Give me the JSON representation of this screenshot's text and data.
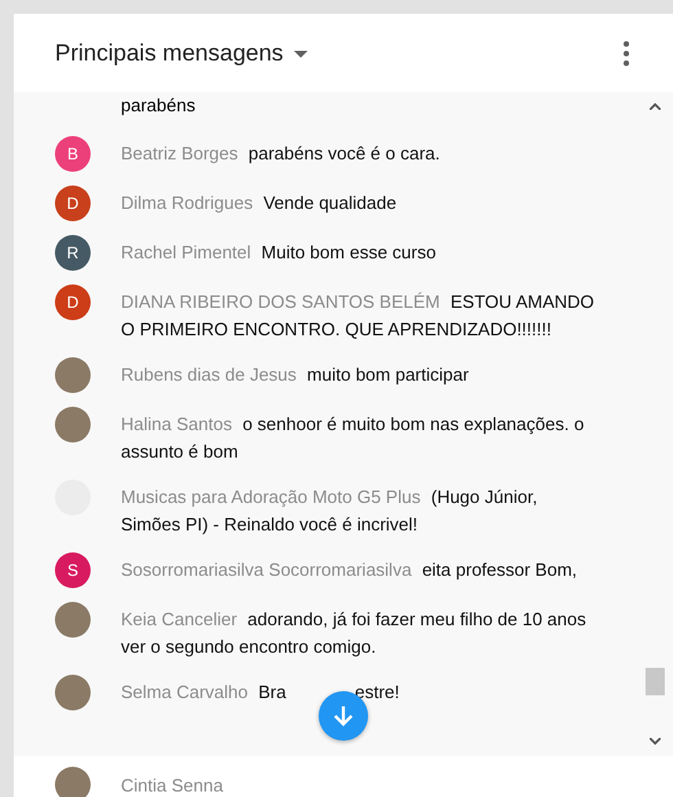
{
  "header": {
    "title": "Principais mensagens"
  },
  "partial_top": {
    "message": "parabéns"
  },
  "messages": [
    {
      "avatar": {
        "kind": "letter",
        "letter": "B",
        "color": "#ec407a"
      },
      "author": "Beatriz Borges",
      "message": "parabéns você é o cara."
    },
    {
      "avatar": {
        "kind": "letter",
        "letter": "D",
        "color": "#c8401c"
      },
      "author": "Dilma Rodrigues",
      "message": "Vende qualidade"
    },
    {
      "avatar": {
        "kind": "letter",
        "letter": "R",
        "color": "#455a64"
      },
      "author": "Rachel Pimentel",
      "message": "Muito bom esse curso"
    },
    {
      "avatar": {
        "kind": "letter",
        "letter": "D",
        "color": "#cc3d18"
      },
      "author": "DIANA RIBEIRO DOS SANTOS BELÉM",
      "message": "ESTOU AMANDO O PRIMEIRO ENCONTRO. QUE APRENDIZADO!!!!!!!"
    },
    {
      "avatar": {
        "kind": "photo"
      },
      "author": "Rubens dias de Jesus",
      "message": "muito bom participar"
    },
    {
      "avatar": {
        "kind": "photo"
      },
      "author": "Halina Santos",
      "message": "o senhoor é muito bom nas explanações. o assunto é bom"
    },
    {
      "avatar": {
        "kind": "logo"
      },
      "author": "Musicas para Adoração Moto G5 Plus",
      "message": "(Hugo Júnior, Simões PI) - Reinaldo você é incrivel!"
    },
    {
      "avatar": {
        "kind": "letter",
        "letter": "S",
        "color": "#d81b60"
      },
      "author": "Sosorromariasilva Socorromariasilva",
      "message": "eita professor Bom,"
    },
    {
      "avatar": {
        "kind": "photo"
      },
      "author": "Keia Cancelier",
      "message": "adorando, já foi fazer meu filho de 10 anos ver o segundo encontro comigo."
    },
    {
      "avatar": {
        "kind": "photo"
      },
      "author": "Selma Carvalho",
      "message": "Bra",
      "message_after": "estre!"
    }
  ],
  "composer": {
    "author": "Cintia Senna"
  }
}
